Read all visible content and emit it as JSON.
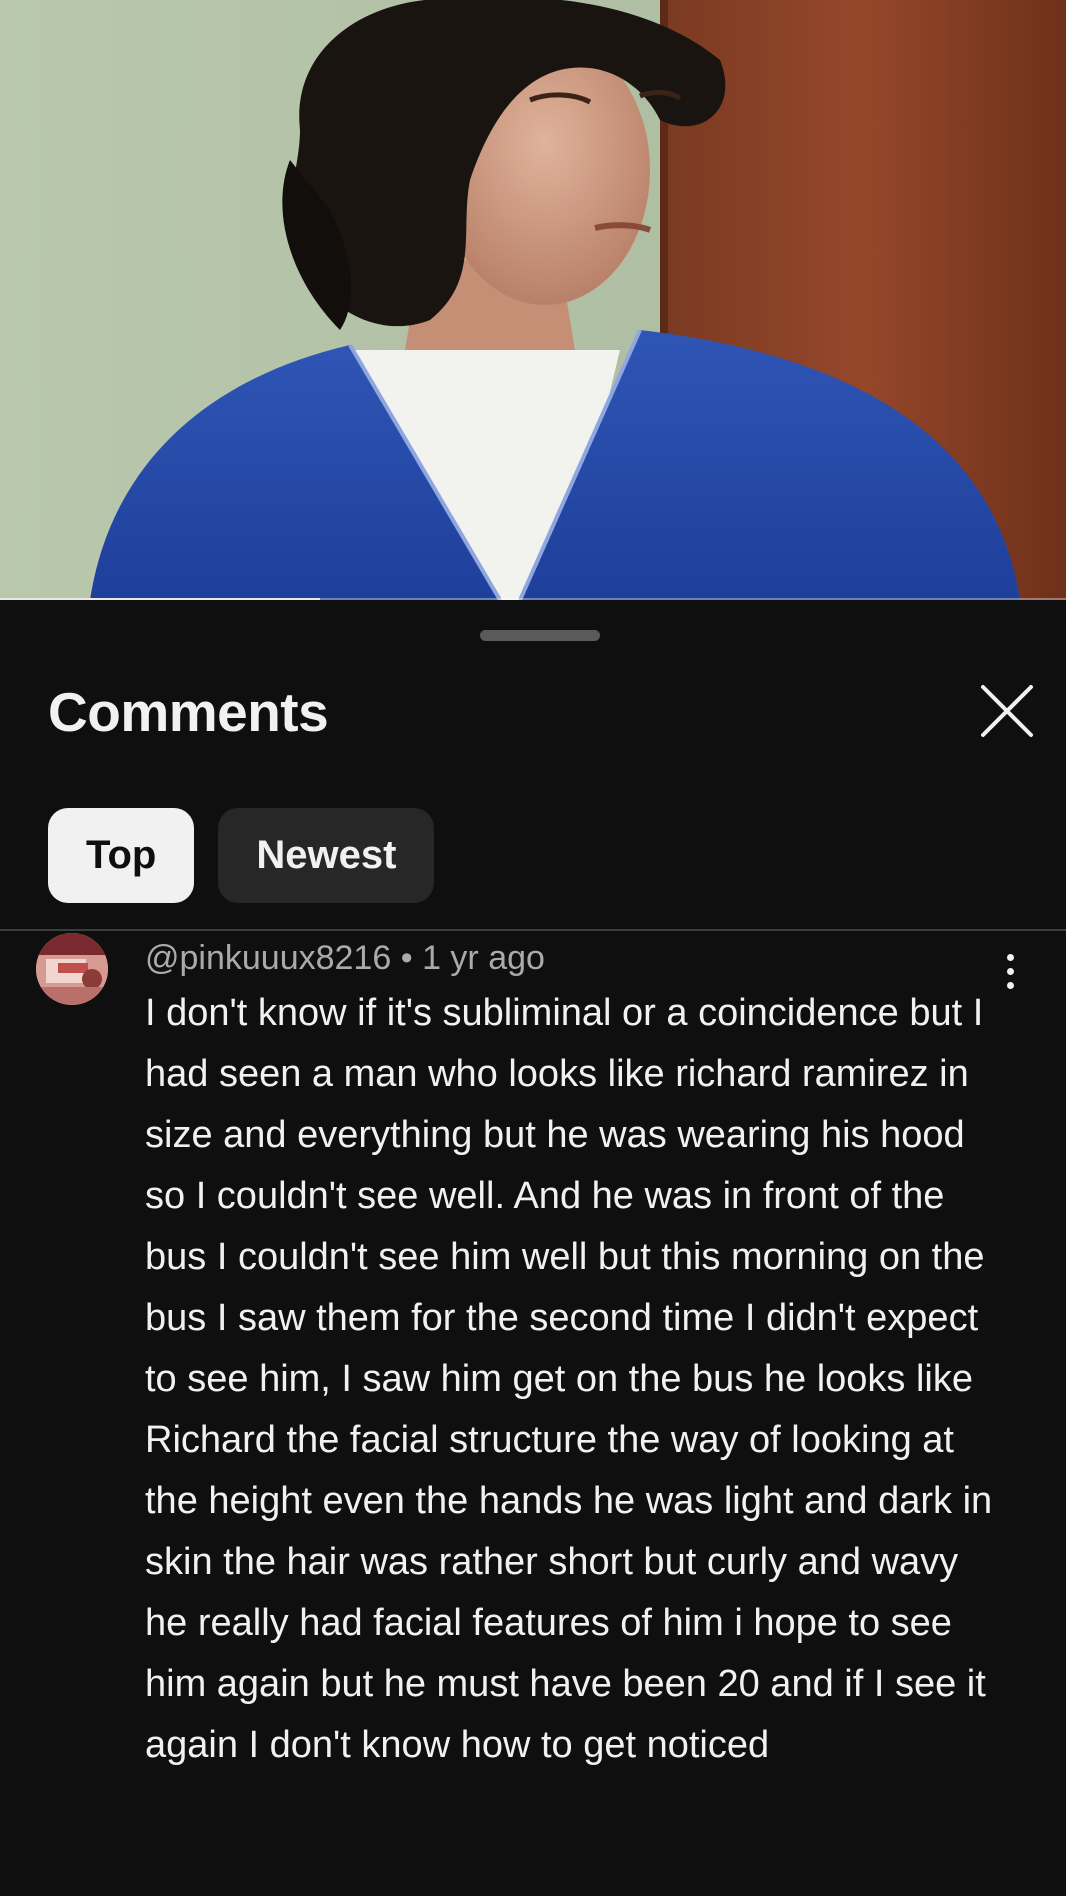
{
  "video": {
    "progress": 0.3,
    "thumbnail_description_icon": "video-thumbnail"
  },
  "comments_panel": {
    "title": "Comments",
    "close_icon": "close-icon",
    "filters": [
      {
        "label": "Top",
        "selected": true
      },
      {
        "label": "Newest",
        "selected": false
      }
    ]
  },
  "comment": {
    "author": "@pinkuuux8216",
    "separator": "•",
    "time": "1 yr ago",
    "text": "I don't know if it's subliminal or a coincidence but I had seen a man who looks like richard ramirez in size and everything but he was wearing his hood so I couldn't see well. And he was in front of the bus I couldn't see him well but this morning on the bus I saw them for the second time I didn't expect to see him, I saw him get on the bus he looks like Richard the facial structure the way of looking at the height even the hands he was light and dark in skin the hair was rather short but curly and wavy he really had facial features of him i hope to see him again but he must have been 20 and if I see it again I don't know how to get noticed",
    "more_icon": "more-vert-icon"
  },
  "colors": {
    "background": "#0f0f0f",
    "text": "#f1f1f1",
    "secondary_text": "#aaaaaa",
    "chip_inactive": "#272727"
  }
}
